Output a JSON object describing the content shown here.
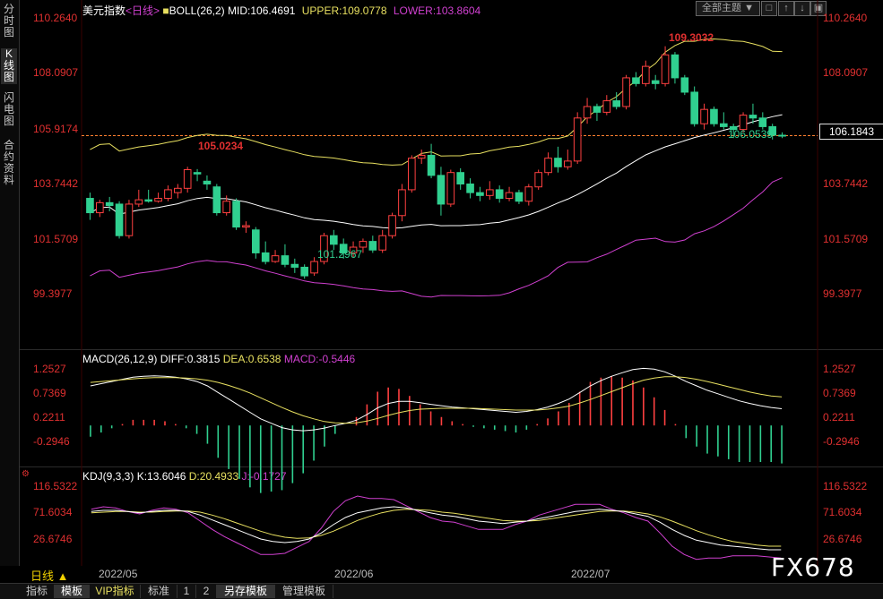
{
  "left_tabs": [
    {
      "label": "分时图",
      "active": false
    },
    {
      "label": "K线图",
      "active": true
    },
    {
      "label": "闪电图",
      "active": false
    },
    {
      "label": "合约资料",
      "active": false
    }
  ],
  "main_header": {
    "symbol": "美元指数",
    "period": "<日线>",
    "boll": "BOLL(26,2)",
    "mid": "MID:106.4691",
    "upper": "UPPER:109.0778",
    "lower": "LOWER:103.8604"
  },
  "top_buttons": {
    "theme_select": "全部主题",
    "theme_arrow": "▼"
  },
  "price_axis": [
    "110.2640",
    "108.0907",
    "105.9174",
    "103.7442",
    "101.5709",
    "99.3977"
  ],
  "current_price": "106.1843",
  "annotations": {
    "high": "109.3032",
    "low": "101.2967",
    "local_high": "105.0234",
    "recent_low": "106.0539"
  },
  "macd_header": {
    "name": "MACD(26,12,9)",
    "diff": "DIFF:0.3815",
    "dea": "DEA:0.6538",
    "macd": "MACD:-0.5446"
  },
  "macd_axis": [
    "1.2527",
    "0.7369",
    "0.2211",
    "-0.2946"
  ],
  "kdj_header": {
    "name": "KDJ(9,3,3)",
    "k": "K:13.6046",
    "d": "D:20.4933",
    "j": "J:-0.1727"
  },
  "kdj_axis": [
    "116.5322",
    "71.6034",
    "26.6746"
  ],
  "period_label": "日线",
  "period_arrow": "▲",
  "date_labels": [
    "2022/05",
    "2022/06",
    "2022/07"
  ],
  "bottom_tabs": [
    "指标",
    "模板",
    "VIP指标",
    "标准",
    "1",
    "2",
    "另存模板",
    "管理模板"
  ],
  "watermark": "FX678",
  "colors": {
    "up": "#ff4040",
    "down": "#30d090",
    "mid": "#ffffff",
    "upper": "#e8e060",
    "lower": "#d040d0",
    "axis": "#e03030",
    "dea": "#e8e060",
    "macdlabel": "#d040d0"
  },
  "chart_data": {
    "type": "candlestick",
    "title": "美元指数 <日线>",
    "candles": [
      [
        104.0,
        103.5,
        104.2,
        103.25
      ],
      [
        103.5,
        103.85,
        103.95,
        103.35
      ],
      [
        103.85,
        103.75,
        104.05,
        103.55
      ],
      [
        103.8,
        102.7,
        103.9,
        102.6
      ],
      [
        102.7,
        103.8,
        103.95,
        102.6
      ],
      [
        103.8,
        103.95,
        104.3,
        103.7
      ],
      [
        103.95,
        103.9,
        104.3,
        103.85
      ],
      [
        103.9,
        104.0,
        104.2,
        103.85
      ],
      [
        104.0,
        104.3,
        104.45,
        103.9
      ],
      [
        104.2,
        104.35,
        104.5,
        104.0
      ],
      [
        104.35,
        105.0,
        105.1,
        104.2
      ],
      [
        104.9,
        104.85,
        105.02,
        104.6
      ],
      [
        104.6,
        104.5,
        104.8,
        104.3
      ],
      [
        104.4,
        103.5,
        104.5,
        103.4
      ],
      [
        103.5,
        103.9,
        104.1,
        103.4
      ],
      [
        103.9,
        103.0,
        104.0,
        102.9
      ],
      [
        103.0,
        103.05,
        103.2,
        102.8
      ],
      [
        102.9,
        102.1,
        103.0,
        101.9
      ],
      [
        102.1,
        101.8,
        102.5,
        101.7
      ],
      [
        101.8,
        102.0,
        102.2,
        101.75
      ],
      [
        102.0,
        101.7,
        102.4,
        101.6
      ],
      [
        101.7,
        101.6,
        101.9,
        101.4
      ],
      [
        101.6,
        101.3,
        101.7,
        101.2
      ],
      [
        101.4,
        101.8,
        101.95,
        101.3
      ],
      [
        101.8,
        102.7,
        102.8,
        101.7
      ],
      [
        102.7,
        102.4,
        102.9,
        102.2
      ],
      [
        102.4,
        102.1,
        102.6,
        101.9
      ],
      [
        102.1,
        102.3,
        102.5,
        101.95
      ],
      [
        102.3,
        102.5,
        102.6,
        102.1
      ],
      [
        102.5,
        102.2,
        102.7,
        102.1
      ],
      [
        102.2,
        102.7,
        102.9,
        102.1
      ],
      [
        102.7,
        103.4,
        103.5,
        102.6
      ],
      [
        103.4,
        104.3,
        104.5,
        103.2
      ],
      [
        104.3,
        105.4,
        105.5,
        104.2
      ],
      [
        105.4,
        105.5,
        105.7,
        105.2
      ],
      [
        105.5,
        104.8,
        105.9,
        104.7
      ],
      [
        104.8,
        103.8,
        105.1,
        103.4
      ],
      [
        103.8,
        104.9,
        105.0,
        103.7
      ],
      [
        104.9,
        104.5,
        105.05,
        104.3
      ],
      [
        104.5,
        104.2,
        104.7,
        104.0
      ],
      [
        104.2,
        104.1,
        104.4,
        103.9
      ],
      [
        104.1,
        104.3,
        104.6,
        103.95
      ],
      [
        104.3,
        104.0,
        104.45,
        103.85
      ],
      [
        104.0,
        104.2,
        104.4,
        103.9
      ],
      [
        104.2,
        103.9,
        104.3,
        103.8
      ],
      [
        103.9,
        104.4,
        104.5,
        103.75
      ],
      [
        104.4,
        104.9,
        105.0,
        104.3
      ],
      [
        104.9,
        105.4,
        105.6,
        104.8
      ],
      [
        105.4,
        105.1,
        105.8,
        104.9
      ],
      [
        105.1,
        105.3,
        105.7,
        105.0
      ],
      [
        105.3,
        106.8,
        107.0,
        105.2
      ],
      [
        106.8,
        107.2,
        107.5,
        106.6
      ],
      [
        107.2,
        107.0,
        107.3,
        106.7
      ],
      [
        107.0,
        107.4,
        107.6,
        106.9
      ],
      [
        107.4,
        107.2,
        107.7,
        107.1
      ],
      [
        107.2,
        108.2,
        108.3,
        107.1
      ],
      [
        108.2,
        108.0,
        108.4,
        107.9
      ],
      [
        108.0,
        108.6,
        108.8,
        107.9
      ],
      [
        108.1,
        108.0,
        108.3,
        107.8
      ],
      [
        108.0,
        109.0,
        109.3,
        107.9
      ],
      [
        109.0,
        108.2,
        109.1,
        108.0
      ],
      [
        108.2,
        107.7,
        108.3,
        107.6
      ],
      [
        107.7,
        106.6,
        107.9,
        106.5
      ],
      [
        106.6,
        107.1,
        107.3,
        106.4
      ],
      [
        107.1,
        106.6,
        107.2,
        106.5
      ],
      [
        106.6,
        106.5,
        107.0,
        106.4
      ],
      [
        106.5,
        106.4,
        106.6,
        106.1
      ],
      [
        106.4,
        106.9,
        107.0,
        106.3
      ],
      [
        106.9,
        106.8,
        107.3,
        106.6
      ],
      [
        106.8,
        106.5,
        107.0,
        106.4
      ],
      [
        106.5,
        106.2,
        106.6,
        106.05
      ],
      [
        106.2,
        106.18,
        106.3,
        106.1
      ]
    ],
    "ylim": [
      98.9,
      110.6
    ],
    "macd": {
      "diff": [
        0.9,
        0.95,
        1.0,
        1.05,
        1.1,
        1.12,
        1.13,
        1.12,
        1.1,
        1.06,
        1.0,
        0.9,
        0.75,
        0.6,
        0.45,
        0.3,
        0.15,
        0.05,
        -0.05,
        -0.1,
        -0.12,
        -0.1,
        -0.06,
        0.0,
        0.05,
        0.12,
        0.25,
        0.4,
        0.5,
        0.55,
        0.55,
        0.52,
        0.48,
        0.45,
        0.42,
        0.4,
        0.38,
        0.36,
        0.34,
        0.32,
        0.3,
        0.32,
        0.36,
        0.42,
        0.5,
        0.6,
        0.75,
        0.9,
        1.02,
        1.12,
        1.2,
        1.27,
        1.3,
        1.28,
        1.22,
        1.12,
        1.0,
        0.9,
        0.8,
        0.72,
        0.64,
        0.56,
        0.5,
        0.45,
        0.41,
        0.38
      ],
      "dea": [
        0.98,
        1.0,
        1.02,
        1.04,
        1.06,
        1.08,
        1.09,
        1.09,
        1.09,
        1.08,
        1.06,
        1.03,
        0.98,
        0.91,
        0.83,
        0.74,
        0.63,
        0.52,
        0.41,
        0.31,
        0.22,
        0.15,
        0.09,
        0.06,
        0.05,
        0.06,
        0.1,
        0.16,
        0.23,
        0.29,
        0.34,
        0.37,
        0.38,
        0.39,
        0.39,
        0.39,
        0.39,
        0.38,
        0.37,
        0.36,
        0.35,
        0.35,
        0.35,
        0.37,
        0.4,
        0.44,
        0.51,
        0.59,
        0.68,
        0.77,
        0.86,
        0.95,
        1.03,
        1.08,
        1.11,
        1.11,
        1.09,
        1.05,
        1.0,
        0.94,
        0.88,
        0.82,
        0.76,
        0.71,
        0.67,
        0.65
      ],
      "ylim": [
        -0.75,
        1.45
      ]
    },
    "kdj": {
      "k": [
        78,
        80,
        80,
        78,
        76,
        78,
        80,
        80,
        78,
        72,
        64,
        56,
        48,
        40,
        32,
        28,
        26,
        28,
        32,
        42,
        56,
        68,
        76,
        80,
        84,
        86,
        84,
        80,
        76,
        72,
        70,
        66,
        62,
        60,
        58,
        60,
        62,
        66,
        70,
        74,
        78,
        80,
        82,
        80,
        78,
        74,
        70,
        60,
        48,
        38,
        30,
        26,
        22,
        20,
        18,
        16,
        14,
        14
      ],
      "d": [
        76,
        77,
        78,
        78,
        77,
        77,
        78,
        79,
        79,
        77,
        72,
        66,
        59,
        52,
        45,
        39,
        35,
        33,
        34,
        38,
        45,
        54,
        63,
        70,
        76,
        80,
        82,
        81,
        80,
        77,
        75,
        72,
        69,
        66,
        63,
        62,
        62,
        63,
        66,
        69,
        72,
        75,
        78,
        79,
        79,
        77,
        74,
        69,
        62,
        54,
        46,
        39,
        33,
        28,
        25,
        22,
        20,
        20
      ],
      "j": [
        82,
        86,
        84,
        78,
        74,
        80,
        84,
        82,
        76,
        62,
        48,
        36,
        26,
        16,
        6,
        6,
        8,
        18,
        28,
        50,
        78,
        96,
        104,
        100,
        100,
        98,
        88,
        78,
        68,
        62,
        60,
        54,
        48,
        48,
        48,
        56,
        62,
        72,
        78,
        84,
        90,
        90,
        90,
        82,
        76,
        68,
        62,
        42,
        20,
        6,
        -2,
        0,
        0,
        4,
        4,
        4,
        2,
        0
      ],
      "ylim": [
        -10,
        125
      ]
    }
  }
}
